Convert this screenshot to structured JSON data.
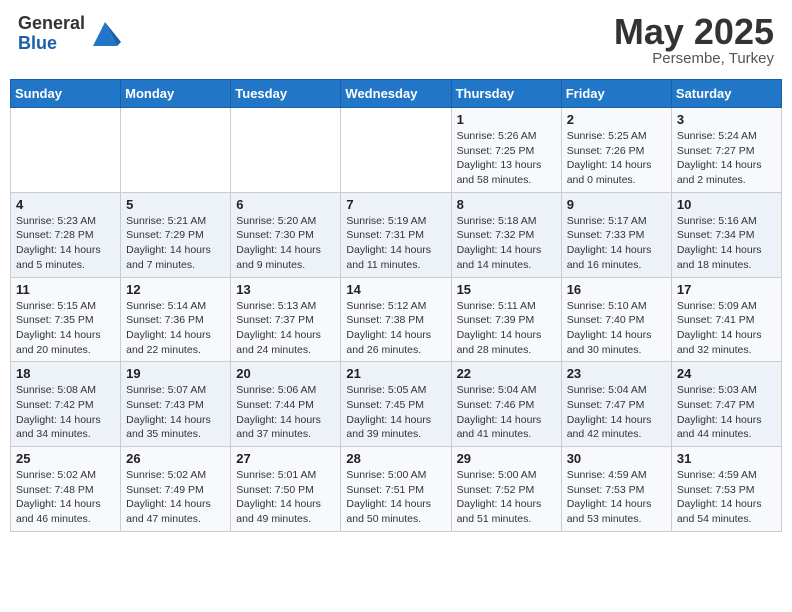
{
  "header": {
    "logo_general": "General",
    "logo_blue": "Blue",
    "month": "May 2025",
    "location": "Persembe, Turkey"
  },
  "weekdays": [
    "Sunday",
    "Monday",
    "Tuesday",
    "Wednesday",
    "Thursday",
    "Friday",
    "Saturday"
  ],
  "weeks": [
    [
      {
        "day": "",
        "info": ""
      },
      {
        "day": "",
        "info": ""
      },
      {
        "day": "",
        "info": ""
      },
      {
        "day": "",
        "info": ""
      },
      {
        "day": "1",
        "info": "Sunrise: 5:26 AM\nSunset: 7:25 PM\nDaylight: 13 hours\nand 58 minutes."
      },
      {
        "day": "2",
        "info": "Sunrise: 5:25 AM\nSunset: 7:26 PM\nDaylight: 14 hours\nand 0 minutes."
      },
      {
        "day": "3",
        "info": "Sunrise: 5:24 AM\nSunset: 7:27 PM\nDaylight: 14 hours\nand 2 minutes."
      }
    ],
    [
      {
        "day": "4",
        "info": "Sunrise: 5:23 AM\nSunset: 7:28 PM\nDaylight: 14 hours\nand 5 minutes."
      },
      {
        "day": "5",
        "info": "Sunrise: 5:21 AM\nSunset: 7:29 PM\nDaylight: 14 hours\nand 7 minutes."
      },
      {
        "day": "6",
        "info": "Sunrise: 5:20 AM\nSunset: 7:30 PM\nDaylight: 14 hours\nand 9 minutes."
      },
      {
        "day": "7",
        "info": "Sunrise: 5:19 AM\nSunset: 7:31 PM\nDaylight: 14 hours\nand 11 minutes."
      },
      {
        "day": "8",
        "info": "Sunrise: 5:18 AM\nSunset: 7:32 PM\nDaylight: 14 hours\nand 14 minutes."
      },
      {
        "day": "9",
        "info": "Sunrise: 5:17 AM\nSunset: 7:33 PM\nDaylight: 14 hours\nand 16 minutes."
      },
      {
        "day": "10",
        "info": "Sunrise: 5:16 AM\nSunset: 7:34 PM\nDaylight: 14 hours\nand 18 minutes."
      }
    ],
    [
      {
        "day": "11",
        "info": "Sunrise: 5:15 AM\nSunset: 7:35 PM\nDaylight: 14 hours\nand 20 minutes."
      },
      {
        "day": "12",
        "info": "Sunrise: 5:14 AM\nSunset: 7:36 PM\nDaylight: 14 hours\nand 22 minutes."
      },
      {
        "day": "13",
        "info": "Sunrise: 5:13 AM\nSunset: 7:37 PM\nDaylight: 14 hours\nand 24 minutes."
      },
      {
        "day": "14",
        "info": "Sunrise: 5:12 AM\nSunset: 7:38 PM\nDaylight: 14 hours\nand 26 minutes."
      },
      {
        "day": "15",
        "info": "Sunrise: 5:11 AM\nSunset: 7:39 PM\nDaylight: 14 hours\nand 28 minutes."
      },
      {
        "day": "16",
        "info": "Sunrise: 5:10 AM\nSunset: 7:40 PM\nDaylight: 14 hours\nand 30 minutes."
      },
      {
        "day": "17",
        "info": "Sunrise: 5:09 AM\nSunset: 7:41 PM\nDaylight: 14 hours\nand 32 minutes."
      }
    ],
    [
      {
        "day": "18",
        "info": "Sunrise: 5:08 AM\nSunset: 7:42 PM\nDaylight: 14 hours\nand 34 minutes."
      },
      {
        "day": "19",
        "info": "Sunrise: 5:07 AM\nSunset: 7:43 PM\nDaylight: 14 hours\nand 35 minutes."
      },
      {
        "day": "20",
        "info": "Sunrise: 5:06 AM\nSunset: 7:44 PM\nDaylight: 14 hours\nand 37 minutes."
      },
      {
        "day": "21",
        "info": "Sunrise: 5:05 AM\nSunset: 7:45 PM\nDaylight: 14 hours\nand 39 minutes."
      },
      {
        "day": "22",
        "info": "Sunrise: 5:04 AM\nSunset: 7:46 PM\nDaylight: 14 hours\nand 41 minutes."
      },
      {
        "day": "23",
        "info": "Sunrise: 5:04 AM\nSunset: 7:47 PM\nDaylight: 14 hours\nand 42 minutes."
      },
      {
        "day": "24",
        "info": "Sunrise: 5:03 AM\nSunset: 7:47 PM\nDaylight: 14 hours\nand 44 minutes."
      }
    ],
    [
      {
        "day": "25",
        "info": "Sunrise: 5:02 AM\nSunset: 7:48 PM\nDaylight: 14 hours\nand 46 minutes."
      },
      {
        "day": "26",
        "info": "Sunrise: 5:02 AM\nSunset: 7:49 PM\nDaylight: 14 hours\nand 47 minutes."
      },
      {
        "day": "27",
        "info": "Sunrise: 5:01 AM\nSunset: 7:50 PM\nDaylight: 14 hours\nand 49 minutes."
      },
      {
        "day": "28",
        "info": "Sunrise: 5:00 AM\nSunset: 7:51 PM\nDaylight: 14 hours\nand 50 minutes."
      },
      {
        "day": "29",
        "info": "Sunrise: 5:00 AM\nSunset: 7:52 PM\nDaylight: 14 hours\nand 51 minutes."
      },
      {
        "day": "30",
        "info": "Sunrise: 4:59 AM\nSunset: 7:53 PM\nDaylight: 14 hours\nand 53 minutes."
      },
      {
        "day": "31",
        "info": "Sunrise: 4:59 AM\nSunset: 7:53 PM\nDaylight: 14 hours\nand 54 minutes."
      }
    ]
  ]
}
